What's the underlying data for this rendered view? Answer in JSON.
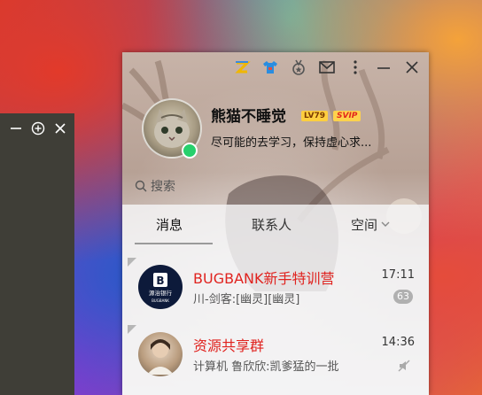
{
  "mini_window": {
    "buttons": [
      "minimize-icon",
      "maximize-icon",
      "close-icon"
    ]
  },
  "titlebar": {
    "icons": [
      "theme-icon",
      "shirt-icon",
      "medal-icon",
      "mail-icon",
      "more-icon",
      "minimize-icon",
      "close-icon"
    ]
  },
  "profile": {
    "nickname": "熊猫不睡觉",
    "level_badge": "LV79",
    "vip_badge": "SVIP",
    "signature": "尽可能的去学习，保持虚心求...",
    "status_color": "#27d06c"
  },
  "search": {
    "placeholder": "搜索"
  },
  "tabs": [
    {
      "label": "消息",
      "active": true
    },
    {
      "label": "联系人",
      "active": false
    },
    {
      "label": "空间",
      "active": false
    }
  ],
  "conversations": [
    {
      "name": "BUGBANK新手特训营",
      "message": "川-剑客:[幽灵][幽灵]",
      "time": "17:11",
      "unread": "63",
      "avatar_brand": "源治银行",
      "avatar_sub": "BUGBANK"
    },
    {
      "name": "资源共享群",
      "message": "计算机 鲁欣欣:凯爹猛的一批",
      "time": "14:36",
      "muted": true
    }
  ],
  "colors": {
    "group_name": "#e0231f",
    "online": "#27d06c",
    "vip": "#ffd24d"
  }
}
